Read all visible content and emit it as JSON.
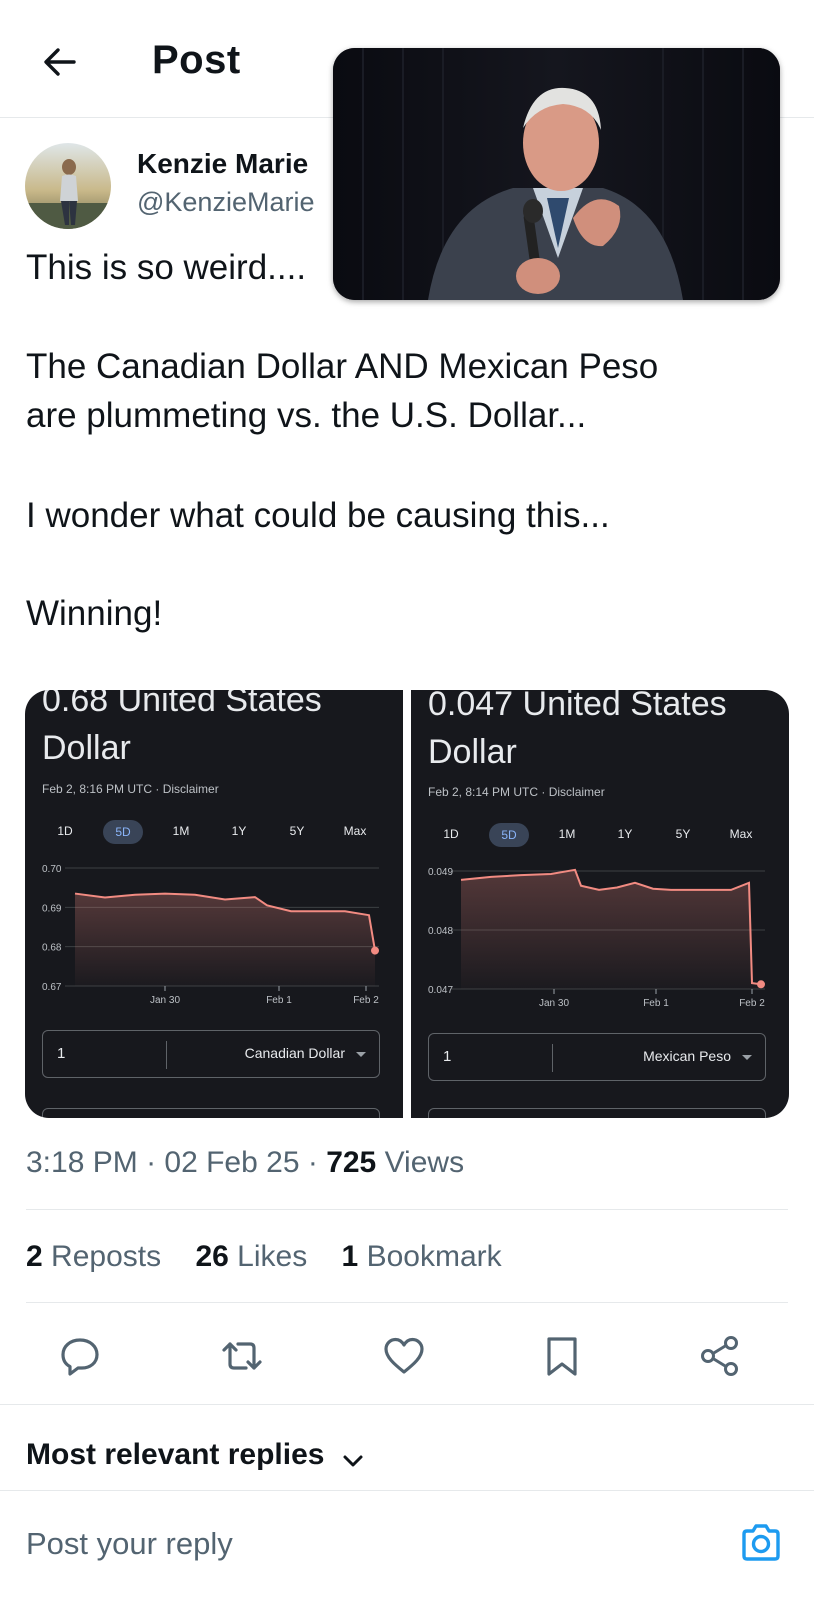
{
  "header": {
    "title": "Post"
  },
  "author": {
    "name": "Kenzie Marie",
    "handle": "@KenzieMarie"
  },
  "post": {
    "lines": [
      "This is so weird....",
      "The Canadian Dollar AND Mexican Peso",
      "are plummeting vs. the U.S. Dollar...",
      "I wonder what could be causing this...",
      "Winning!"
    ]
  },
  "media": {
    "left": {
      "title_line1": "0.68 United States",
      "title_line2": "Dollar",
      "date": "Feb 2, 8:16 PM UTC · Disclaimer",
      "ranges": [
        "1D",
        "5D",
        "1M",
        "1Y",
        "5Y",
        "Max"
      ],
      "active_range": "5D",
      "amount": "1",
      "currency": "Canadian Dollar"
    },
    "right": {
      "title_line1": "0.047 United States",
      "title_line2": "Dollar",
      "date": "Feb 2, 8:14 PM UTC · Disclaimer",
      "ranges": [
        "1D",
        "5D",
        "1M",
        "1Y",
        "5Y",
        "Max"
      ],
      "active_range": "5D",
      "amount": "1",
      "currency": "Mexican Peso"
    }
  },
  "chart_data": [
    {
      "type": "line",
      "title": "0.68 United States Dollar",
      "x_ticks": [
        "Jan 30",
        "Feb 1",
        "Feb 2"
      ],
      "y_ticks": [
        "0.70",
        "0.69",
        "0.68",
        "0.67"
      ],
      "ylim": [
        0.67,
        0.7
      ],
      "x": [
        0,
        0.5,
        1,
        1.5,
        2,
        2.5,
        3,
        3.2,
        3.6,
        4,
        4.5,
        4.9,
        5
      ],
      "values": [
        0.6935,
        0.6925,
        0.6932,
        0.6935,
        0.6932,
        0.692,
        0.6926,
        0.6905,
        0.689,
        0.689,
        0.689,
        0.688,
        0.679
      ],
      "x_tick_positions": [
        1.5,
        3.4,
        4.85
      ],
      "grid": true,
      "color": "#f28b82"
    },
    {
      "type": "line",
      "title": "0.047 United States Dollar",
      "x_ticks": [
        "Jan 30",
        "Feb 1",
        "Feb 2"
      ],
      "y_ticks": [
        "0.049",
        "0.048",
        "0.047"
      ],
      "ylim": [
        0.047,
        0.049
      ],
      "x": [
        0,
        0.5,
        1,
        1.5,
        1.9,
        2.0,
        2.3,
        2.6,
        2.9,
        3.2,
        3.5,
        4,
        4.5,
        4.8,
        4.85,
        5
      ],
      "values": [
        0.04885,
        0.0489,
        0.04893,
        0.04895,
        0.04902,
        0.04875,
        0.04868,
        0.04872,
        0.0488,
        0.0487,
        0.04868,
        0.04868,
        0.04868,
        0.0488,
        0.0471,
        0.04708
      ],
      "x_tick_positions": [
        1.55,
        3.25,
        4.85
      ],
      "grid": true,
      "color": "#f28b82"
    }
  ],
  "meta": {
    "time": "3:18 PM",
    "date": "02 Feb 25",
    "views_count": "725",
    "views_label": "Views"
  },
  "stats": [
    {
      "count": "2",
      "label": "Reposts"
    },
    {
      "count": "26",
      "label": "Likes"
    },
    {
      "count": "1",
      "label": "Bookmark"
    }
  ],
  "replies": {
    "sort_label": "Most relevant replies",
    "input_placeholder": "Post your reply"
  },
  "colors": {
    "accent": "#1d9bf0",
    "muted": "#536471",
    "chart_line": "#f28b82",
    "panel_bg": "#17181d"
  }
}
